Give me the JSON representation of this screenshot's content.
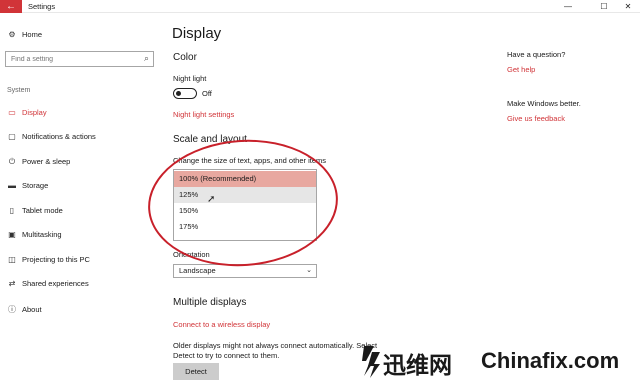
{
  "window": {
    "title": "Settings",
    "back_glyph": "←",
    "controls": {
      "minimize": "—",
      "maximize": "☐",
      "close": "✕"
    }
  },
  "sidebar": {
    "home_label": "Home",
    "search_placeholder": "Find a setting",
    "section_label": "System",
    "items": [
      {
        "label": "Display",
        "icon": "monitor-icon",
        "active": true
      },
      {
        "label": "Notifications & actions",
        "icon": "notification-icon"
      },
      {
        "label": "Power & sleep",
        "icon": "power-icon"
      },
      {
        "label": "Storage",
        "icon": "storage-icon"
      },
      {
        "label": "Tablet mode",
        "icon": "tablet-icon"
      },
      {
        "label": "Multitasking",
        "icon": "multitasking-icon"
      },
      {
        "label": "Projecting to this PC",
        "icon": "projector-icon"
      },
      {
        "label": "Shared experiences",
        "icon": "share-icon"
      },
      {
        "label": "About",
        "icon": "info-icon"
      }
    ]
  },
  "main": {
    "title": "Display",
    "color": {
      "heading": "Color",
      "night_light_label": "Night light",
      "night_light_state": "Off",
      "night_light_settings_link": "Night light settings"
    },
    "scale": {
      "heading": "Scale and layout",
      "label": "Change the size of text, apps, and other items",
      "options": [
        "100% (Recommended)",
        "125%",
        "150%",
        "175%"
      ],
      "selected_index": 0,
      "hover_index": 1
    },
    "orientation": {
      "label": "Orientation",
      "value": "Landscape"
    },
    "multiple": {
      "heading": "Multiple displays",
      "link": "Connect to a wireless display",
      "desc_line1": "Older displays might not always connect automatically. Select",
      "desc_line2": "Detect to try to connect to them.",
      "detect_label": "Detect"
    }
  },
  "right_panel": {
    "question_heading": "Have a question?",
    "help_link": "Get help",
    "better_heading": "Make Windows better.",
    "feedback_link": "Give us feedback"
  },
  "watermark": {
    "text1": "迅维网",
    "text2": "Chinafix.com"
  },
  "colors": {
    "accent": "#d13438",
    "selected_option": "#e8a8a0",
    "annotation_oval": "#c8202a"
  }
}
